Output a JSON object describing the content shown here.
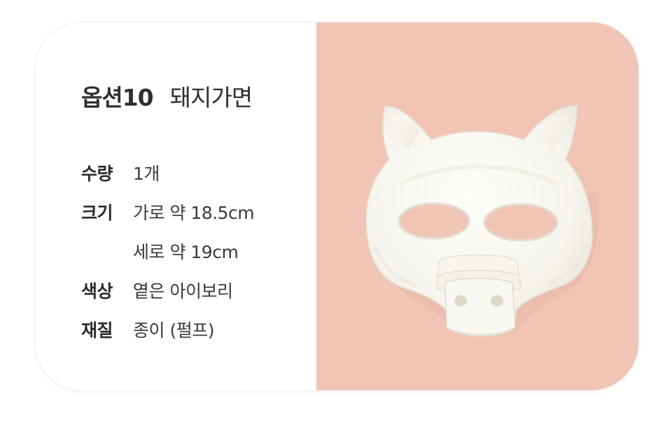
{
  "title": {
    "option": "옵션10",
    "name": "돼지가면"
  },
  "specs": [
    {
      "label": "수량",
      "value": "1개"
    },
    {
      "label": "크기",
      "value": "가로 약 18.5cm"
    },
    {
      "label": "",
      "value": "세로 약 19cm"
    },
    {
      "label": "색상",
      "value": "옅은 아이보리"
    },
    {
      "label": "재질",
      "value": "종이 (펄프)"
    }
  ],
  "colors": {
    "photo_background": "#f1c5b6",
    "mask": "#fbfaf5",
    "text": "#333333"
  },
  "image": {
    "subject": "pig-mask-icon"
  }
}
